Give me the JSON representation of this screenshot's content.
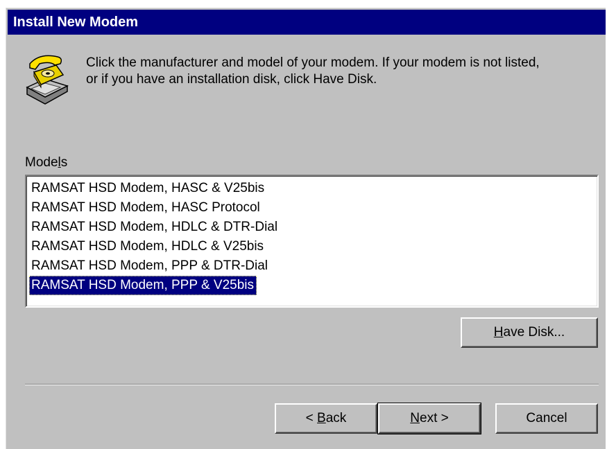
{
  "window": {
    "title": "Install New Modem"
  },
  "header": {
    "icon": "telephone-modem-icon",
    "instruction_line1": "Click the manufacturer and model of your modem. If your modem is not listed,",
    "instruction_line2": "or if you have an installation disk, click Have Disk."
  },
  "models": {
    "label_pre": "Mode",
    "label_accel": "l",
    "label_post": "s",
    "items": [
      "RAMSAT HSD Modem, HASC & V25bis",
      "RAMSAT HSD Modem, HASC Protocol",
      "RAMSAT HSD Modem, HDLC & DTR-Dial",
      "RAMSAT HSD Modem, HDLC & V25bis",
      "RAMSAT HSD Modem, PPP & DTR-Dial",
      "RAMSAT HSD Modem, PPP & V25bis"
    ],
    "selected_index": 5
  },
  "buttons": {
    "have_disk_accel": "H",
    "have_disk_rest": "ave Disk...",
    "back_prefix": "< ",
    "back_accel": "B",
    "back_rest": "ack",
    "next_accel": "N",
    "next_rest": "ext >",
    "cancel": "Cancel"
  },
  "colors": {
    "dialog_bg": "#c0c0c0",
    "titlebar_bg": "#000080",
    "selection_bg": "#000080"
  }
}
